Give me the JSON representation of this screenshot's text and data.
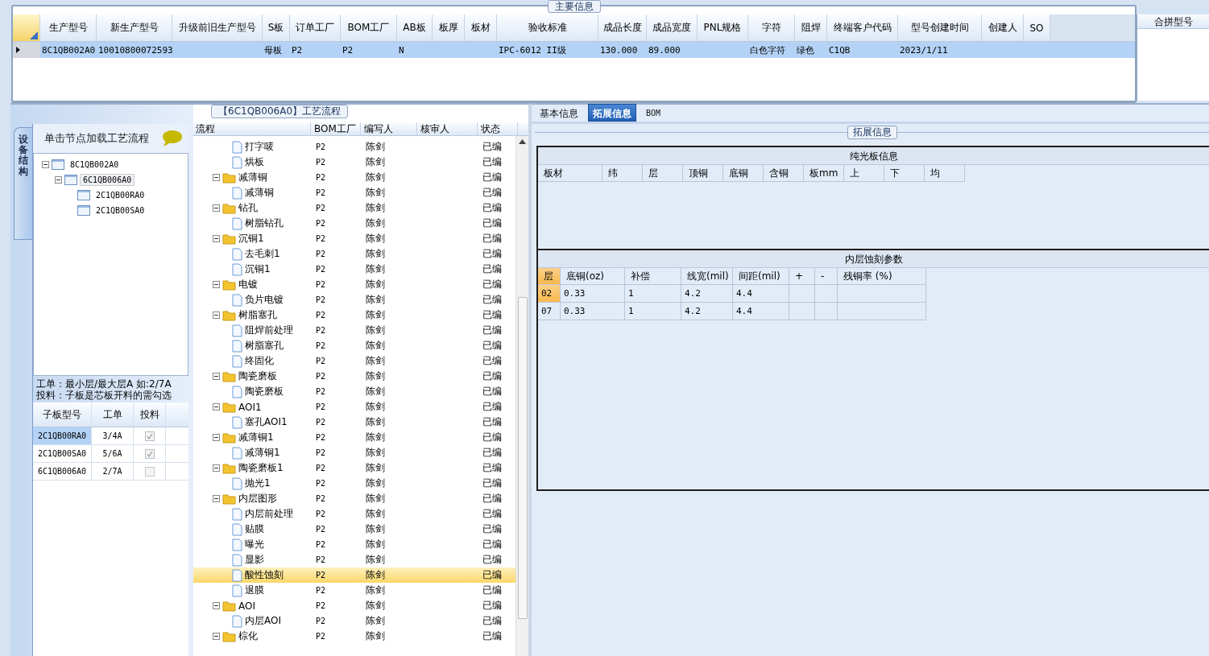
{
  "main_info": {
    "title": "主要信息",
    "columns": [
      "生产型号",
      "新生产型号",
      "升级前旧生产型号",
      "S板",
      "订单工厂",
      "BOM工厂",
      "AB板",
      "板厚",
      "板材",
      "验收标准",
      "成品长度",
      "成品宽度",
      "PNL规格",
      "字符",
      "阻焊",
      "终端客户代码",
      "型号创建时间",
      "创建人",
      "SO"
    ],
    "rows": [
      {
        "selected": true,
        "cells": [
          "8C1QB002A0",
          "10010800072593",
          "",
          "母板",
          "P2",
          "P2",
          "N",
          "",
          "",
          "IPC-6012 II级",
          "130.000",
          "89.000",
          "",
          "白色字符",
          "绿色",
          "C1QB",
          "2023/1/11",
          "",
          ""
        ]
      }
    ]
  },
  "merge_panel": {
    "title": "合拼型号"
  },
  "structure_panel": {
    "tab": "设备结构",
    "hint": "单击节点加载工艺流程",
    "tree": [
      {
        "label": "8C1QB002A0",
        "selected": false,
        "children": [
          {
            "label": "6C1QB006A0",
            "selected": true,
            "children": [
              {
                "label": "2C1QB00RA0",
                "selected": false
              },
              {
                "label": "2C1QB00SA0",
                "selected": false
              }
            ]
          }
        ]
      }
    ],
    "notes": [
      "工单：最小层/最大层A 如:2/7A",
      "投料：子板是芯板开料的需勾选"
    ],
    "sub_table": {
      "columns": [
        "子板型号",
        "工单",
        "投料"
      ],
      "rows": [
        {
          "cells": [
            "2C1QB00RA0",
            "3/4A"
          ],
          "checked": true,
          "selected": true
        },
        {
          "cells": [
            "2C1QB00SA0",
            "5/6A"
          ],
          "checked": true,
          "selected": false
        },
        {
          "cells": [
            "6C1QB006A0",
            "2/7A"
          ],
          "checked": false,
          "selected": false
        }
      ]
    }
  },
  "process": {
    "title": "【6C1QB006A0】工艺流程",
    "columns": [
      "流程",
      "BOM工厂",
      "编写人",
      "核审人",
      "状态"
    ],
    "groups": [
      {
        "children": [
          {
            "name": "打字唛",
            "bom": "P2",
            "writer": "陈剑",
            "status": "已编",
            "selected": false
          },
          {
            "name": "烘板",
            "bom": "P2",
            "writer": "陈剑",
            "status": "已编",
            "selected": false
          }
        ]
      },
      {
        "name": "减薄铜",
        "bom": "P2",
        "writer": "陈剑",
        "status": "已编",
        "selected": false,
        "children": [
          {
            "name": "减薄铜",
            "bom": "P2",
            "writer": "陈剑",
            "status": "已编",
            "selected": false
          }
        ]
      },
      {
        "name": "钻孔",
        "bom": "P2",
        "writer": "陈剑",
        "status": "已编",
        "selected": false,
        "children": [
          {
            "name": "树脂钻孔",
            "bom": "P2",
            "writer": "陈剑",
            "status": "已编",
            "selected": false
          }
        ]
      },
      {
        "name": "沉铜1",
        "bom": "P2",
        "writer": "陈剑",
        "status": "已编",
        "selected": false,
        "children": [
          {
            "name": "去毛刺1",
            "bom": "P2",
            "writer": "陈剑",
            "status": "已编",
            "selected": false
          },
          {
            "name": "沉铜1",
            "bom": "P2",
            "writer": "陈剑",
            "status": "已编",
            "selected": false
          }
        ]
      },
      {
        "name": "电镀",
        "bom": "P2",
        "writer": "陈剑",
        "status": "已编",
        "selected": false,
        "children": [
          {
            "name": "负片电镀",
            "bom": "P2",
            "writer": "陈剑",
            "status": "已编",
            "selected": false
          }
        ]
      },
      {
        "name": "树脂塞孔",
        "bom": "P2",
        "writer": "陈剑",
        "status": "已编",
        "selected": false,
        "children": [
          {
            "name": "阻焊前处理",
            "bom": "P2",
            "writer": "陈剑",
            "status": "已编",
            "selected": false
          },
          {
            "name": "树脂塞孔",
            "bom": "P2",
            "writer": "陈剑",
            "status": "已编",
            "selected": false
          },
          {
            "name": "终固化",
            "bom": "P2",
            "writer": "陈剑",
            "status": "已编",
            "selected": false
          }
        ]
      },
      {
        "name": "陶瓷磨板",
        "bom": "P2",
        "writer": "陈剑",
        "status": "已编",
        "selected": false,
        "children": [
          {
            "name": "陶瓷磨板",
            "bom": "P2",
            "writer": "陈剑",
            "status": "已编",
            "selected": false
          }
        ]
      },
      {
        "name": "AOI1",
        "bom": "P2",
        "writer": "陈剑",
        "status": "已编",
        "selected": false,
        "children": [
          {
            "name": "塞孔AOI1",
            "bom": "P2",
            "writer": "陈剑",
            "status": "已编",
            "selected": false
          }
        ]
      },
      {
        "name": "减薄铜1",
        "bom": "P2",
        "writer": "陈剑",
        "status": "已编",
        "selected": false,
        "children": [
          {
            "name": "减薄铜1",
            "bom": "P2",
            "writer": "陈剑",
            "status": "已编",
            "selected": false
          }
        ]
      },
      {
        "name": "陶瓷磨板1",
        "bom": "P2",
        "writer": "陈剑",
        "status": "已编",
        "selected": false,
        "children": [
          {
            "name": "抛光1",
            "bom": "P2",
            "writer": "陈剑",
            "status": "已编",
            "selected": false
          }
        ]
      },
      {
        "name": "内层图形",
        "bom": "P2",
        "writer": "陈剑",
        "status": "已编",
        "selected": false,
        "children": [
          {
            "name": "内层前处理",
            "bom": "P2",
            "writer": "陈剑",
            "status": "已编",
            "selected": false
          },
          {
            "name": "贴膜",
            "bom": "P2",
            "writer": "陈剑",
            "status": "已编",
            "selected": false
          },
          {
            "name": "曝光",
            "bom": "P2",
            "writer": "陈剑",
            "status": "已编",
            "selected": false
          },
          {
            "name": "显影",
            "bom": "P2",
            "writer": "陈剑",
            "status": "已编",
            "selected": false
          },
          {
            "name": "酸性蚀刻",
            "bom": "P2",
            "writer": "陈剑",
            "status": "已编",
            "selected": true
          },
          {
            "name": "退膜",
            "bom": "P2",
            "writer": "陈剑",
            "status": "已编",
            "selected": false
          }
        ]
      },
      {
        "name": "AOI",
        "bom": "P2",
        "writer": "陈剑",
        "status": "已编",
        "selected": false,
        "children": [
          {
            "name": "内层AOI",
            "bom": "P2",
            "writer": "陈剑",
            "status": "已编",
            "selected": false
          }
        ]
      },
      {
        "name": "棕化",
        "bom": "P2",
        "writer": "陈剑",
        "status": "已编",
        "selected": false
      }
    ]
  },
  "detail": {
    "tabs": [
      {
        "label": "基本信息",
        "selected": false
      },
      {
        "label": "拓展信息",
        "selected": true
      },
      {
        "label": "BOM",
        "selected": false
      }
    ],
    "section_title": "拓展信息",
    "plain_board": {
      "title": "纯光板信息",
      "columns": [
        "板材",
        "纬",
        "层",
        "顶铜",
        "底铜",
        "含铜",
        "板mm",
        "上",
        "下",
        "均"
      ]
    },
    "etch": {
      "title": "内层蚀刻参数",
      "columns": [
        "层",
        "底铜(oz)",
        "补偿",
        "线宽(mil)",
        "间距(mil)",
        "+",
        "-",
        "残铜率 (%)"
      ],
      "rows": [
        {
          "selected": true,
          "cells": [
            "02",
            "0.33",
            "1",
            "4.2",
            "4.4",
            "",
            "",
            ""
          ]
        },
        {
          "selected": false,
          "cells": [
            "07",
            "0.33",
            "1",
            "4.2",
            "4.4",
            "",
            "",
            ""
          ]
        }
      ]
    }
  }
}
